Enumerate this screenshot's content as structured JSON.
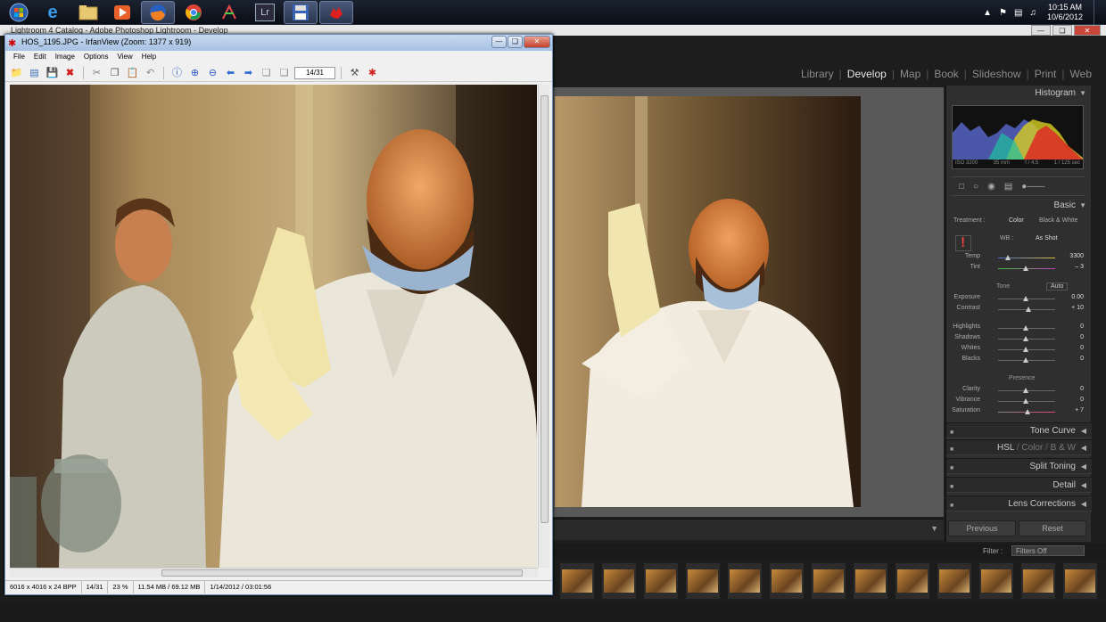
{
  "taskbar": {
    "clock_time": "10:15 AM",
    "clock_date": "10/6/2012",
    "apps": [
      "start-orb",
      "internet-explorer",
      "explorer",
      "media-player",
      "firefox",
      "chrome",
      "app",
      "lightroom",
      "save",
      "irfanview"
    ],
    "lightroom_label": "Lr"
  },
  "lightroom": {
    "window_title": "Lightroom 4 Catalog - Adobe Photoshop Lightroom - Develop",
    "modules": [
      "Library",
      "Develop",
      "Map",
      "Book",
      "Slideshow",
      "Print",
      "Web"
    ],
    "active_module": "Develop",
    "panels": {
      "histogram": "Histogram",
      "histogram_info": {
        "iso": "ISO 3200",
        "focal": "35 mm",
        "aperture": "f / 4.5",
        "shutter": "1 / 125 sec"
      },
      "basic": "Basic",
      "treatment_label": "Treatment :",
      "treatment_color": "Color",
      "treatment_bw": "Black & White",
      "wb_label": "WB :",
      "wb_value": "As Shot",
      "temp_label": "Temp",
      "temp_value": "3300",
      "tint_label": "Tint",
      "tint_value": "– 3",
      "tone_label": "Tone",
      "auto_label": "Auto",
      "exposure_label": "Exposure",
      "exposure_value": "0.00",
      "contrast_label": "Contrast",
      "contrast_value": "+ 10",
      "highlights_label": "Highlights",
      "highlights_value": "0",
      "shadows_label": "Shadows",
      "shadows_value": "0",
      "whites_label": "Whites",
      "whites_value": "0",
      "blacks_label": "Blacks",
      "blacks_value": "0",
      "presence_label": "Presence",
      "clarity_label": "Clarity",
      "clarity_value": "0",
      "vibrance_label": "Vibrance",
      "vibrance_value": "0",
      "saturation_label": "Saturation",
      "saturation_value": "+ 7",
      "tone_curve": "Tone Curve",
      "hsl": "HSL",
      "hsl_color": "Color",
      "hsl_bw": "B & W",
      "split_toning": "Split Toning",
      "detail": "Detail",
      "lens_corrections": "Lens Corrections"
    },
    "previous_button": "Previous",
    "reset_button": "Reset",
    "filter_label": "Filter :",
    "filter_value": "Filters Off",
    "filmstrip_count": 13
  },
  "irfanview": {
    "title": "HOS_1195.JPG - IrfanView (Zoom: 1377 x 919)",
    "menu": [
      "File",
      "Edit",
      "Image",
      "Options",
      "View",
      "Help"
    ],
    "page_input": "14/31",
    "status": {
      "dimensions": "6016 x 4016 x 24 BPP",
      "page": "14/31",
      "zoom": "23 %",
      "size": "11.54 MB / 69.12 MB",
      "date": "1/14/2012 / 03:01:56"
    }
  },
  "colors": {
    "lr_background": "#1d1d1d",
    "lr_panel": "#2f2f2f",
    "iv_chrome": "#f0f0f0"
  }
}
